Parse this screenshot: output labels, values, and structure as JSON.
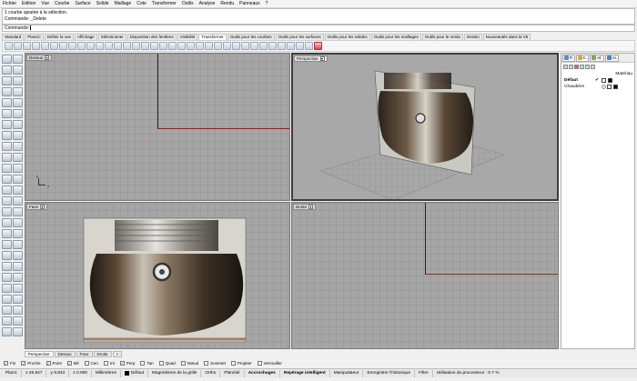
{
  "menu": [
    "Fichier",
    "Edition",
    "Vue",
    "Courbe",
    "Surface",
    "Solide",
    "Maillage",
    "Cote",
    "Transformer",
    "Outils",
    "Analyse",
    "Rendu",
    "Panneaux",
    "?"
  ],
  "command_history": [
    "1 courbe ajoutée à la sélection.",
    "Commande: _Delete"
  ],
  "command_prompt": "Commande:",
  "toolbar_tabs": [
    "Standard",
    "PlansC",
    "Définir la vue",
    "Affichage",
    "Sélectionner",
    "Disposition des fenêtres",
    "Visibilité",
    "Transformer",
    "Outils pour les courbes",
    "Outils pour les surfaces",
    "Outils pour les solides",
    "Outils pour les maillages",
    "Outils pour le rendu",
    "Dessin",
    "Nouveautés dans la V5"
  ],
  "active_toolbar_tab": "Transformer",
  "viewports": {
    "top": {
      "title": "Dessus",
      "dropdown": "▾"
    },
    "perspective": {
      "title": "Perspective",
      "dropdown": "▾"
    },
    "front": {
      "title": "Face",
      "dropdown": "▾"
    },
    "right": {
      "title": "Droite",
      "dropdown": "▾"
    }
  },
  "axis_labels": {
    "x": "x",
    "y": "y"
  },
  "viewport_tabs": [
    "Perspective",
    "Dessus",
    "Face",
    "Droite",
    "+"
  ],
  "active_viewport_tab": "Perspective",
  "osnaps": [
    {
      "label": "Fin",
      "checked": true
    },
    {
      "label": "Proche",
      "checked": true
    },
    {
      "label": "Point",
      "checked": true
    },
    {
      "label": "Mil",
      "checked": true
    },
    {
      "label": "Cen",
      "checked": false
    },
    {
      "label": "Int",
      "checked": false
    },
    {
      "label": "Perp",
      "checked": true
    },
    {
      "label": "Tan",
      "checked": false
    },
    {
      "label": "Quad",
      "checked": false
    },
    {
      "label": "Nœud",
      "checked": false
    },
    {
      "label": "Sommet",
      "checked": false
    },
    {
      "label": "Projeter",
      "checked": false
    },
    {
      "label": "Verrouiller",
      "checked": false
    }
  ],
  "status": {
    "plane": "PlanC",
    "x": "x 26.847",
    "y": "y 8.843",
    "z": "z 0.000",
    "units": "Millimètres",
    "layer": "Défaut",
    "grid_snap": "Magnétisme de la grille",
    "ortho": "Ortho",
    "planar": "Planéité",
    "osnap": "Accrochages",
    "smarttrack": "Repérage intelligent",
    "gumball": "Manipulateur",
    "history": "Enregistrer l'historique",
    "filter": "Filtre",
    "cpu": "Utilisation du processeur : 0.7 %"
  },
  "panel": {
    "tabs": [
      "P.",
      "C.",
      "Af.",
      "Ai."
    ],
    "column_header": "Matériau",
    "layers": [
      {
        "name": "Défaut",
        "current": "✔",
        "color": "#000000",
        "bold": true
      },
      {
        "name": "Chaudière",
        "current": "",
        "color": "#000000",
        "bold": false
      }
    ]
  }
}
